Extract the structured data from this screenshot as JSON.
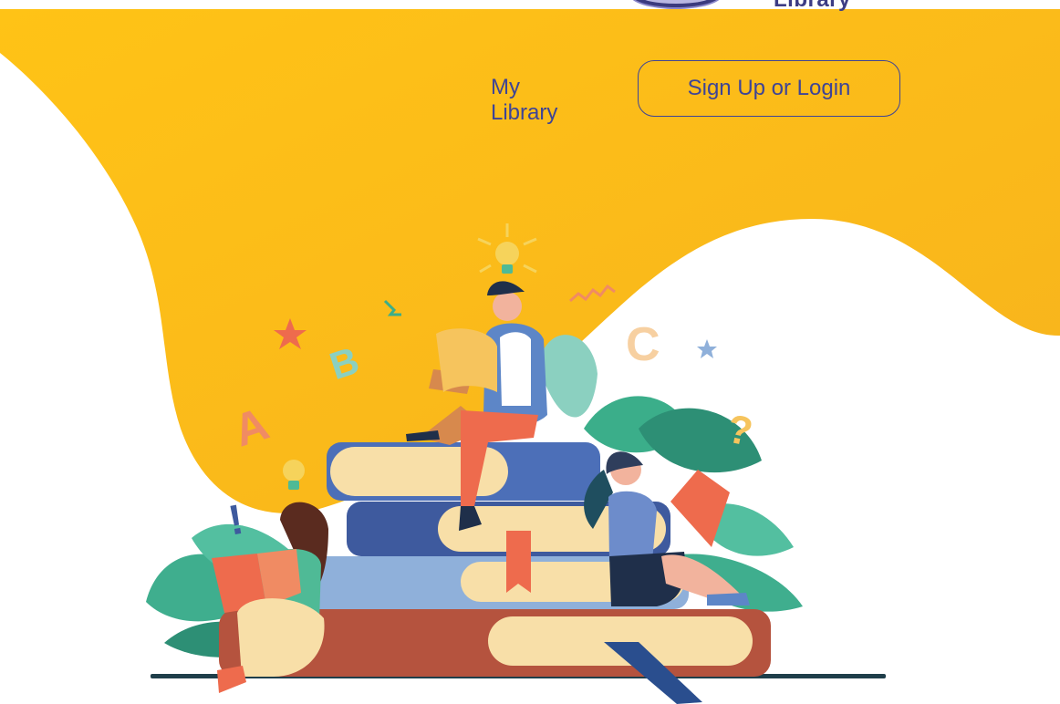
{
  "header": {
    "brand_fragment": "Library"
  },
  "nav": {
    "my_library_label": "My Library",
    "sign_up_login_label": "Sign Up or Login"
  },
  "hero": {
    "letters": {
      "a": "A",
      "b": "B",
      "c": "C",
      "question": "?",
      "exclamation": "!"
    }
  },
  "colors": {
    "primary_yellow": "#FDBF16",
    "text_blue": "#3E4496",
    "book_red": "#B5533E",
    "book_blue": "#3E5A9E",
    "book_cream": "#F8DFA8",
    "leaf_green": "#3BAE8A"
  },
  "icons": {
    "logo": "seal-logo",
    "hero": "reading-people-illustration"
  }
}
